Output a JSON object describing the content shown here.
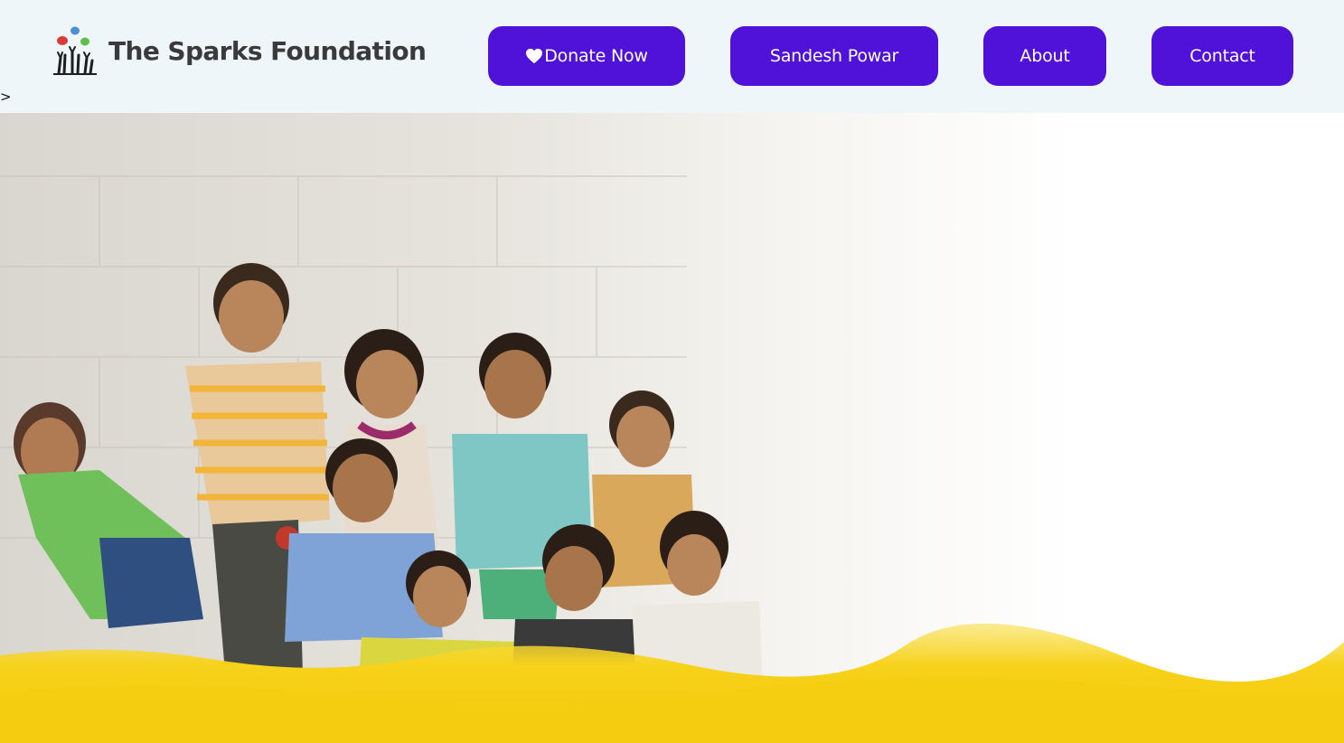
{
  "brand": {
    "name": "The Sparks Foundation",
    "logo_icon": "hands-balloons-logo"
  },
  "nav": {
    "donate_label": "Donate Now",
    "donate_icon": "heart-icon",
    "user_label": "Sandesh Powar",
    "about_label": "About",
    "contact_label": "Contact"
  },
  "misc": {
    "caret": ">"
  },
  "colors": {
    "header_bg": "#eef6fa",
    "button_bg": "#5012d8",
    "button_text": "#ffffff",
    "brand_text": "#3a3a3a",
    "banner_yellow": "#f7d21a"
  }
}
